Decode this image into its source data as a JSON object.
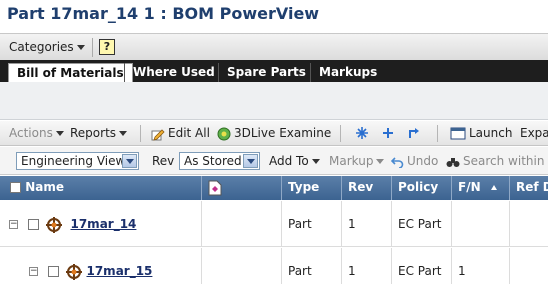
{
  "page": {
    "title": "Part 17mar_14 1 : BOM PowerView"
  },
  "categories_bar": {
    "categories_label": "Categories",
    "help_icon": "help-icon",
    "help_glyph": "?"
  },
  "tabs": [
    {
      "label": "Bill of Materials",
      "active": true
    },
    {
      "label": "Where Used",
      "active": false
    },
    {
      "label": "Spare Parts",
      "active": false
    },
    {
      "label": "Markups",
      "active": false
    }
  ],
  "action_bar": {
    "actions": "Actions",
    "reports": "Reports",
    "edit_all": "Edit All",
    "examine": "3DLive Examine",
    "launch": "Launch",
    "expand": "Expa"
  },
  "filter_bar": {
    "view_selected": "Engineering View",
    "rev_label": "Rev",
    "rev_selected": "As Stored",
    "add_to": "Add To",
    "markup": "Markup",
    "undo": "Undo",
    "search": "Search within"
  },
  "grid": {
    "columns": [
      "Name",
      "",
      "Type",
      "Rev",
      "Policy",
      "F/N",
      "Ref D"
    ],
    "rows": [
      {
        "name": "17mar_14",
        "type": "Part",
        "rev": "1",
        "policy": "EC Part",
        "fn": "",
        "expander": "−"
      },
      {
        "name": "17mar_15",
        "type": "Part",
        "rev": "1",
        "policy": "EC Part",
        "fn": "1",
        "expander": "−"
      }
    ]
  },
  "colors": {
    "title": "#1f3f6e",
    "tab_bar": "#1e1e1e",
    "grid_header": "#3c6391",
    "link": "#1a2f6b"
  }
}
